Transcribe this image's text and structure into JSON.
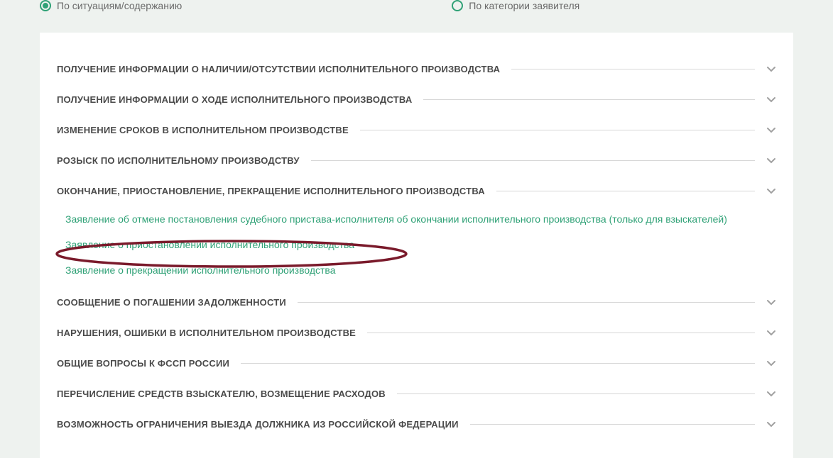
{
  "tabs": {
    "situation": "По ситуациям/содержанию",
    "applicant": "По категории заявителя"
  },
  "sections": [
    {
      "title": "ПОЛУЧЕНИЕ ИНФОРМАЦИИ О НАЛИЧИИ/ОТСУТСТВИИ ИСПОЛНИТЕЛЬНОГО ПРОИЗВОДСТВА"
    },
    {
      "title": "ПОЛУЧЕНИЕ ИНФОРМАЦИИ О ХОДЕ ИСПОЛНИТЕЛЬНОГО ПРОИЗВОДСТВА"
    },
    {
      "title": "ИЗМЕНЕНИЕ СРОКОВ В ИСПОЛНИТЕЛЬНОМ ПРОИЗВОДСТВЕ"
    },
    {
      "title": "РОЗЫСК ПО ИСПОЛНИТЕЛЬНОМУ ПРОИЗВОДСТВУ"
    },
    {
      "title": "ОКОНЧАНИЕ, ПРИОСТАНОВЛЕНИЕ, ПРЕКРАЩЕНИЕ ИСПОЛНИТЕЛЬНОГО ПРОИЗВОДСТВА"
    },
    {
      "title": "СООБЩЕНИЕ О ПОГАШЕНИИ ЗАДОЛЖЕННОСТИ"
    },
    {
      "title": "НАРУШЕНИЯ, ОШИБКИ В ИСПОЛНИТЕЛЬНОМ ПРОИЗВОДСТВЕ"
    },
    {
      "title": "ОБЩИЕ ВОПРОСЫ К ФССП РОССИИ"
    },
    {
      "title": "ПЕРЕЧИСЛЕНИЕ СРЕДСТВ ВЗЫСКАТЕЛЮ, ВОЗМЕЩЕНИЕ РАСХОДОВ"
    },
    {
      "title": "ВОЗМОЖНОСТЬ ОГРАНИЧЕНИЯ ВЫЕЗДА ДОЛЖНИКА ИЗ РОССИЙСКОЙ ФЕДЕРАЦИИ"
    }
  ],
  "sublinks": {
    "cancel": "Заявление об отмене постановления судебного пристава-исполнителя об окончании исполнительного производства (только для взыскателей)",
    "suspend": "Заявление о приостановлении исполнительного производства",
    "terminate": "Заявление о прекращении исполнительного производства"
  }
}
